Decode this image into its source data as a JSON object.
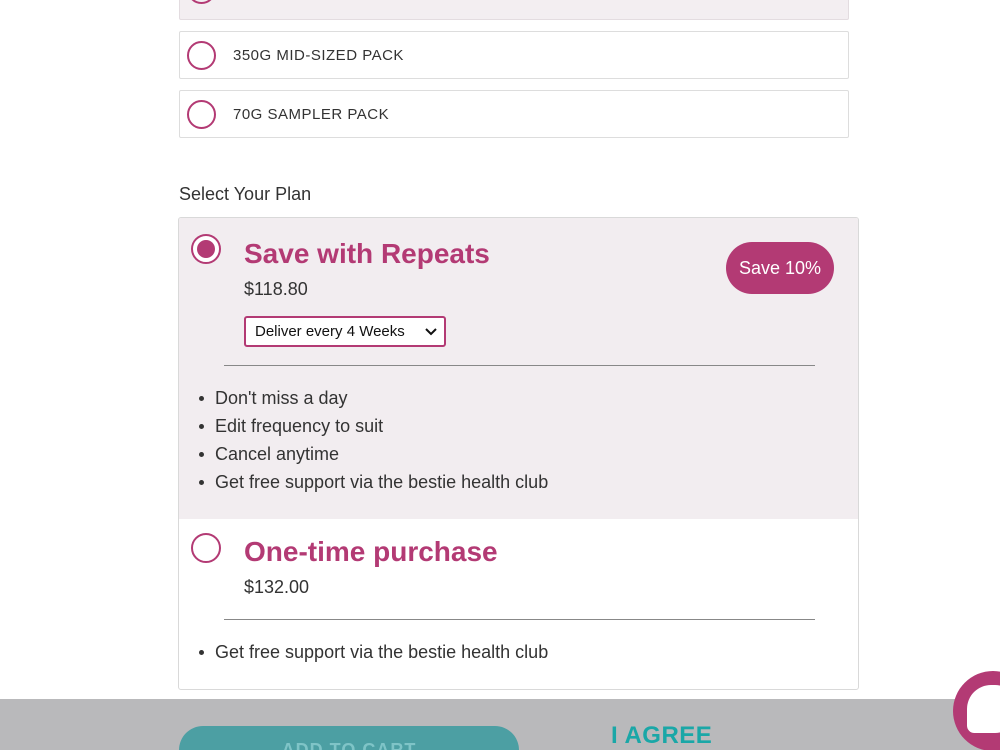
{
  "pack_options": [
    {
      "label": ""
    },
    {
      "label": "350G MID-SIZED PACK"
    },
    {
      "label": "70G SAMPLER PACK"
    }
  ],
  "plan_section": {
    "title": "Select Your Plan"
  },
  "plans": {
    "repeat": {
      "title": "Save with Repeats",
      "price": "$118.80",
      "badge": "Save 10%",
      "frequency": "Deliver every 4 Weeks",
      "benefits": [
        "Don't miss a day",
        "Edit frequency to suit",
        "Cancel anytime",
        "Get free support via the bestie health club"
      ],
      "selected": true
    },
    "one_time": {
      "title": "One-time purchase",
      "price": "$132.00",
      "benefits": [
        "Get free support via the bestie health club"
      ],
      "selected": false
    }
  },
  "footer": {
    "add_to_cart": "ADD TO CART",
    "agree": "I AGREE"
  },
  "colors": {
    "brand": "#b33a74",
    "teal": "#1aa7a7",
    "selected_bg": "#f2edf0"
  },
  "icons": {
    "chat": "chat-bubble-icon",
    "select": "chevron-down-icon"
  }
}
